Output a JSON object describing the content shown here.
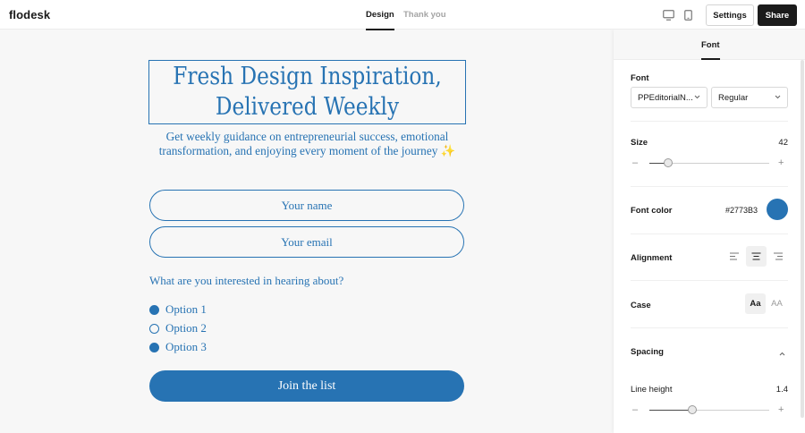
{
  "header": {
    "logo": "flodesk",
    "tabs": [
      {
        "label": "Design",
        "active": true
      },
      {
        "label": "Thank you",
        "active": false
      }
    ],
    "settings_label": "Settings",
    "share_label": "Share"
  },
  "form": {
    "title": "Fresh Design Inspiration, Delivered Weekly",
    "subtitle": "Get weekly guidance on entrepreneurial success, emotional transformation, and enjoying every moment of the journey ✨",
    "name_placeholder": "Your name",
    "email_placeholder": "Your email",
    "question": "What are you interested in hearing about?",
    "options": [
      {
        "label": "Option 1",
        "checked": true
      },
      {
        "label": "Option 2",
        "checked": false
      },
      {
        "label": "Option 3",
        "checked": true
      }
    ],
    "submit_label": "Join the list"
  },
  "panel": {
    "tab": "Font",
    "font_label": "Font",
    "font_family": "PPEditorialN...",
    "font_weight": "Regular",
    "size_label": "Size",
    "size_value": "42",
    "size_slider_fraction": 0.16,
    "color_label": "Font color",
    "color_hex": "#2773B3",
    "alignment_label": "Alignment",
    "alignment_selected": "center",
    "case_label": "Case",
    "case_options": [
      "Aa",
      "AA"
    ],
    "case_selected": "Aa",
    "spacing_label": "Spacing",
    "line_height_label": "Line height",
    "line_height_value": "1.4",
    "line_height_slider_fraction": 0.36
  },
  "colors": {
    "accent": "#2773B3",
    "share_bg": "#1b1b1b"
  }
}
